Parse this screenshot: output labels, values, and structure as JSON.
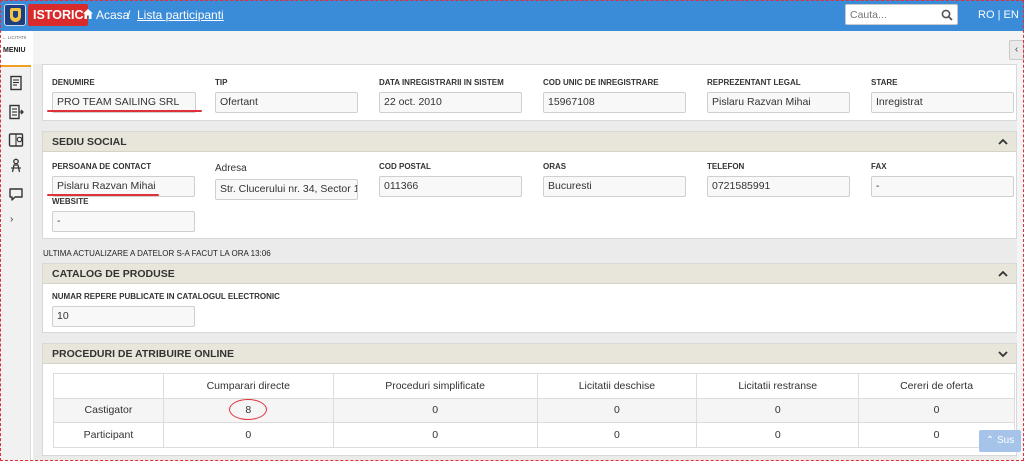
{
  "header": {
    "brand": "ISTORIC",
    "breadcrumb_home": "Acasa",
    "breadcrumb_sep": "/",
    "breadcrumb_current": "Lista participanti",
    "search_placeholder": "Cauta...",
    "lang_ro": "RO",
    "lang_sep": "|",
    "lang_en": "EN",
    "color": "#3a8bd8",
    "brand_color": "#d92b2b"
  },
  "sidebar": {
    "top_small": "← LICITATII",
    "menu": "MENIU",
    "icons": [
      "document-icon",
      "list-export-icon",
      "chart-book-icon",
      "person-tree-icon",
      "chat-bubble-icon"
    ],
    "expand": "›"
  },
  "company": {
    "denumire_label": "DENUMIRE",
    "denumire_value": "PRO TEAM SAILING SRL",
    "tip_label": "TIP",
    "tip_value": "Ofertant",
    "data_label": "DATA INREGISTRARII IN SISTEM",
    "data_value": "22 oct. 2010",
    "cui_label": "COD UNIC DE INREGISTRARE",
    "cui_value": "15967108",
    "repr_label": "REPREZENTANT LEGAL",
    "repr_value": "Pislaru Razvan Mihai",
    "stare_label": "STARE",
    "stare_value": "Inregistrat"
  },
  "sediu": {
    "title": "SEDIU SOCIAL",
    "contact_label": "PERSOANA DE CONTACT",
    "contact_value": "Pislaru Razvan Mihai",
    "adresa_label": "Adresa",
    "adresa_value": "Str. Clucerului nr. 34, Sector 1",
    "cod_label": "COD POSTAL",
    "cod_value": "011366",
    "oras_label": "ORAS",
    "oras_value": "Bucuresti",
    "tel_label": "TELEFON",
    "tel_value": "0721585991",
    "fax_label": "FAX",
    "fax_value": "-",
    "web_label": "WEBSITE",
    "web_value": "-"
  },
  "update_note": "ULTIMA ACTUALIZARE A DATELOR S-A FACUT LA ORA 13:06",
  "catalog": {
    "title": "CATALOG DE PRODUSE",
    "repere_label": "NUMAR REPERE PUBLICATE IN CATALOGUL ELECTRONIC",
    "repere_value": "10"
  },
  "proceduri": {
    "title": "PROCEDURI DE ATRIBUIRE ONLINE",
    "columns": [
      "",
      "Cumparari directe",
      "Proceduri simplificate",
      "Licitatii deschise",
      "Licitatii restranse",
      "Cereri de oferta"
    ],
    "rows": [
      {
        "label": "Castigator",
        "values": [
          "8",
          "0",
          "0",
          "0",
          "0"
        ]
      },
      {
        "label": "Participant",
        "values": [
          "0",
          "0",
          "0",
          "0",
          "0"
        ]
      }
    ]
  },
  "scroll_top": "Sus"
}
